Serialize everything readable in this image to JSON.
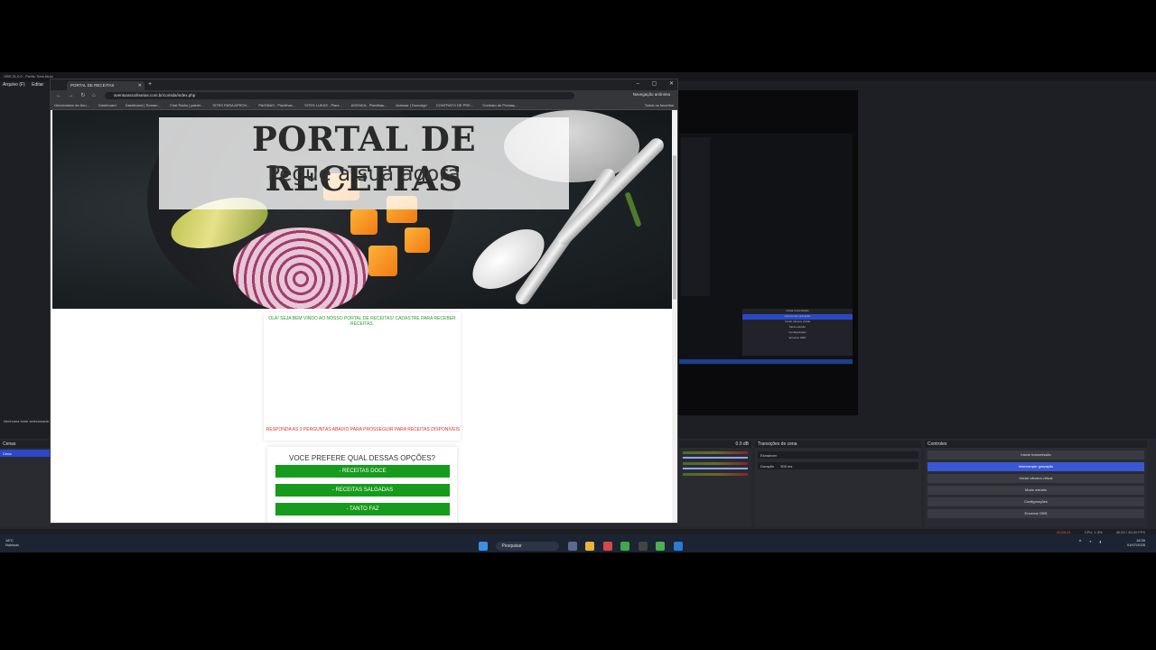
{
  "obs": {
    "title": "OBS 31.0.0 - Perfis: Sem título",
    "menu": [
      "Arquivo (F)",
      "Editar"
    ],
    "scenes_header": "Cenas",
    "scene_item": "Cena",
    "source_hint": "Nenhuma fonte selecionada",
    "mixer_values": [
      "0.0 dB",
      "0.0 dB",
      "0.0 dB"
    ],
    "transitions_header": "Transições de cena",
    "transition_value": "Esmaecer",
    "duration_label": "Duração",
    "duration_value": "300 ms",
    "controls_header": "Controles",
    "controls": [
      "Iniciar transmissão",
      "Interromper gravação",
      "Iniciar câmera virtual",
      "Modo estúdio",
      "Configurações",
      "Encerrar OBS"
    ],
    "mini_list": [
      "Iniciar transmissão",
      "Interromper gravação",
      "Iniciar câmera virtual",
      "Modo estúdio",
      "Configurações",
      "Encerrar OBS"
    ],
    "status": {
      "rec": "00:00:21",
      "cpu": "CPU: 1.3%",
      "fps": "30.00 / 30.00 FPS"
    }
  },
  "browser": {
    "tab_title": "PORTAL DE RECEITAS",
    "url": "aventurasculinarias.com.br/comida/index.php",
    "incognito": "Navegação anônima",
    "bookmarks": [
      "Gerenciador de Anú...",
      "Dashboard",
      "Dashboard | Roman...",
      "Chat Rádio | painel...",
      "SITES PARA APROV...",
      "PAGINAS - Planilhas...",
      "SITES LUKAS - Plani...",
      "AGENDA - Planilhas...",
      "Acessar | Docusign",
      "CONTRATO DE PRE...",
      "Contrato de Prestaç..."
    ],
    "bookmarks_all": "Todos os favoritos"
  },
  "page": {
    "hero_title": "PORTAL DE RECEITAS",
    "hero_subtitle": "Pegue a sua agora",
    "welcome": "OLÁ! SEJA BEM VINDO AO NOSSO PORTAL DE RECEITAS! CADASTRE PARA RECEBER RECEITAS.",
    "answer_prompt": "RESPONDA AS 3 PERGUNTAS ABAIXO PARA PROSSEGUIR PARA RECEITAS DISPONÍVEIS",
    "question": "VOCE PREFERE QUAL DESSAS OPÇÕES?",
    "options": [
      "- RECEITAS DOCE",
      "- RECEITAS SALGADAS",
      "- TANTO FAZ"
    ]
  },
  "taskbar": {
    "weather_temp": "18°C",
    "weather_desc": "Nublado",
    "search_placeholder": "Pesquisar",
    "time": "18:39",
    "date": "01/07/2025"
  },
  "colors": {
    "quiz_button": "#169b1c",
    "welcome_text": "#2a9a2a",
    "answer_text": "#e0302a",
    "obs_accent": "#3a57d6"
  }
}
